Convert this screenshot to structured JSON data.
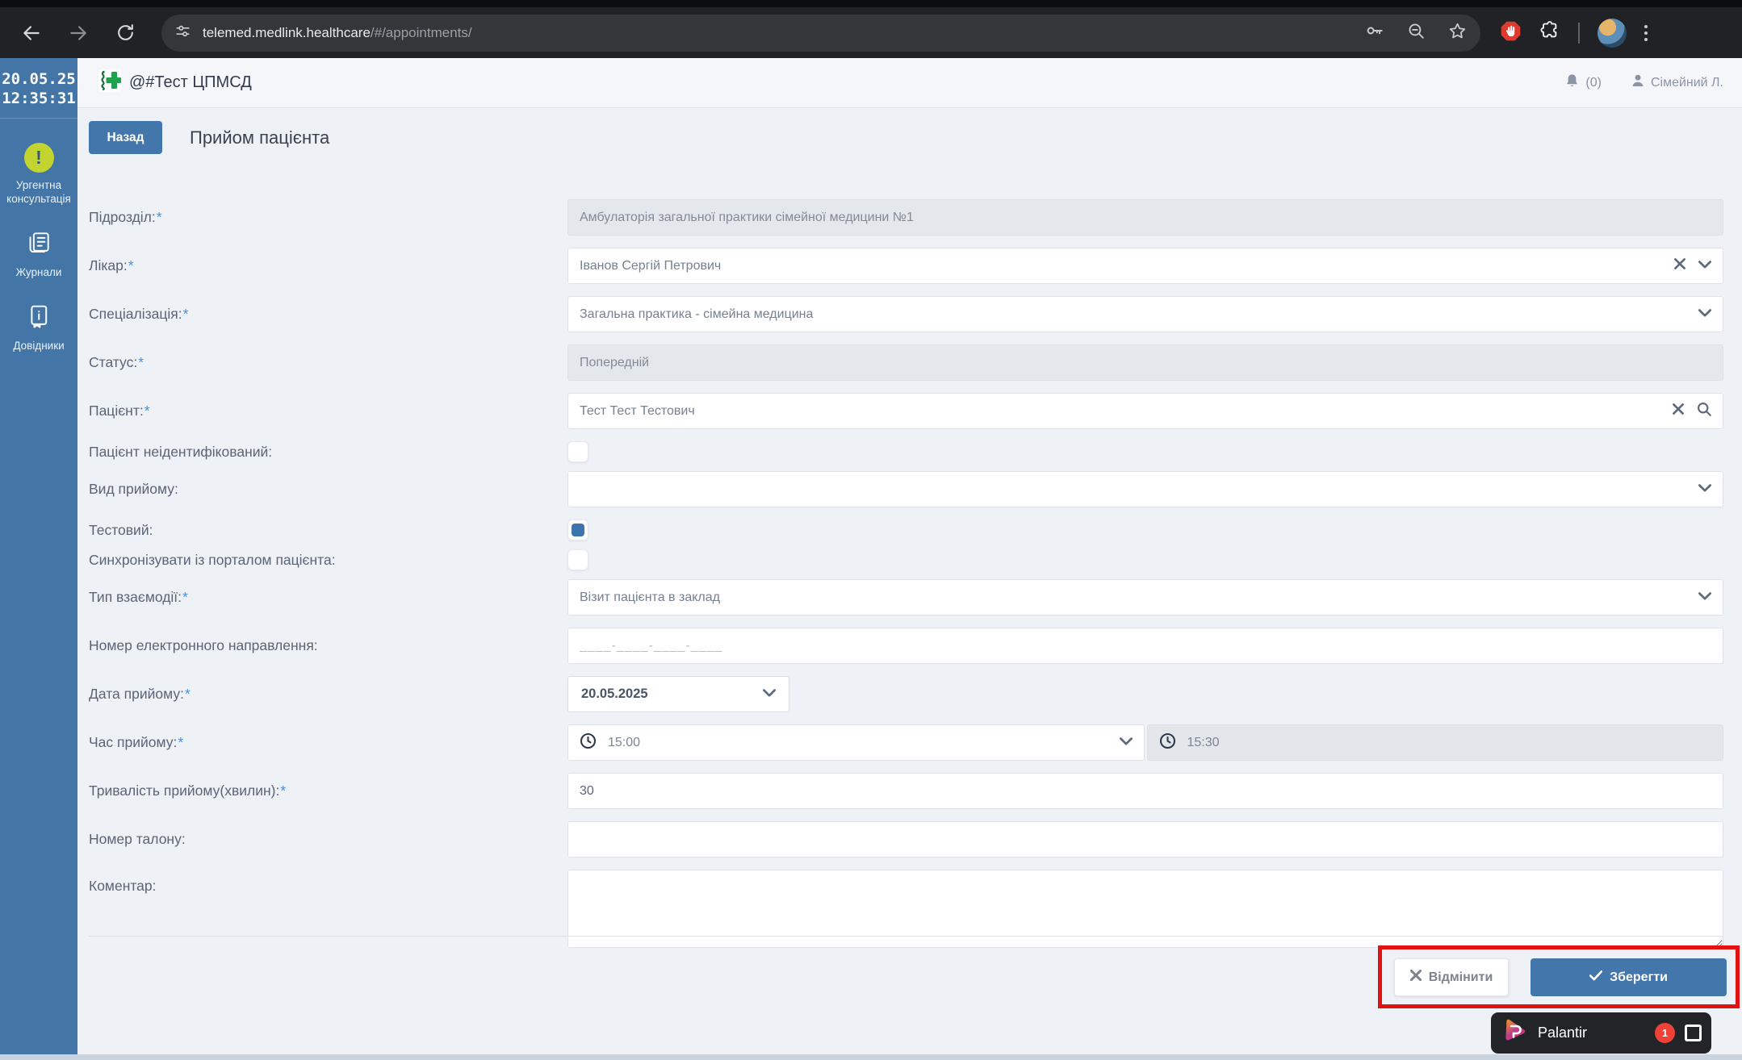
{
  "browser": {
    "url_domain": "telemed.medlink.healthcare",
    "url_path": "/#/appointments/"
  },
  "sidebar": {
    "date": "20.05.25",
    "time": "12:35:31",
    "items": [
      {
        "icon": "urgent-consultation-icon",
        "label": "Ургентна консультація"
      },
      {
        "icon": "journals-icon",
        "label": "Журнали"
      },
      {
        "icon": "directories-icon",
        "label": "Довідники"
      }
    ]
  },
  "header": {
    "title": "@#Тест ЦПМСД",
    "notifications": "(0)",
    "user": "Сімейний Л."
  },
  "page": {
    "back_label": "Назад",
    "title": "Прийом пацієнта"
  },
  "form": {
    "unit": {
      "label": "Підрозділ:",
      "required": "*",
      "value": "Амбулаторія загальної практики сімейної медицини №1"
    },
    "doctor": {
      "label": "Лікар:",
      "required": "*",
      "value": "Іванов Сергій Петрович"
    },
    "specialization": {
      "label": "Спеціалізація:",
      "required": "*",
      "value": "Загальна практика - сімейна медицина"
    },
    "status": {
      "label": "Статус:",
      "required": "*",
      "value": "Попередній"
    },
    "patient": {
      "label": "Пацієнт:",
      "required": "*",
      "value": "Тест Тест Тестович"
    },
    "unidentified": {
      "label": "Пацієнт неідентифікований:",
      "checked": false
    },
    "visit_kind": {
      "label": "Вид прийому:",
      "value": ""
    },
    "test": {
      "label": "Тестовий:",
      "checked": true
    },
    "sync_portal": {
      "label": "Синхронізувати із порталом пацієнта:",
      "checked": false
    },
    "interaction_type": {
      "label": "Тип взаємодії:",
      "required": "*",
      "value": "Візит пацієнта в заклад"
    },
    "referral_number": {
      "label": "Номер електронного направлення:",
      "placeholder": "____-____-____-____",
      "value": ""
    },
    "date": {
      "label": "Дата прийому:",
      "required": "*",
      "value": "20.05.2025"
    },
    "time": {
      "label": "Час прийому:",
      "required": "*",
      "start": "15:00",
      "end": "15:30"
    },
    "duration": {
      "label": "Тривалість прийому(хвилин):",
      "required": "*",
      "value": "30"
    },
    "ticket": {
      "label": "Номер талону:",
      "value": ""
    },
    "comment": {
      "label": "Коментар:",
      "value": ""
    }
  },
  "footer": {
    "cancel_label": "Відмінити",
    "save_label": "Зберегти"
  },
  "palantir": {
    "name": "Palantir",
    "badge": "1"
  },
  "colors": {
    "sidebar_blue": "#4475a7",
    "primary_button_blue": "#4377ab",
    "checkbox_blue": "#3e74ad",
    "urgent_yellow_green": "#c3d431",
    "annotation_red": "#e01212",
    "palantir_badge_red": "#ef4136",
    "logo_green": "#1fa14d"
  }
}
